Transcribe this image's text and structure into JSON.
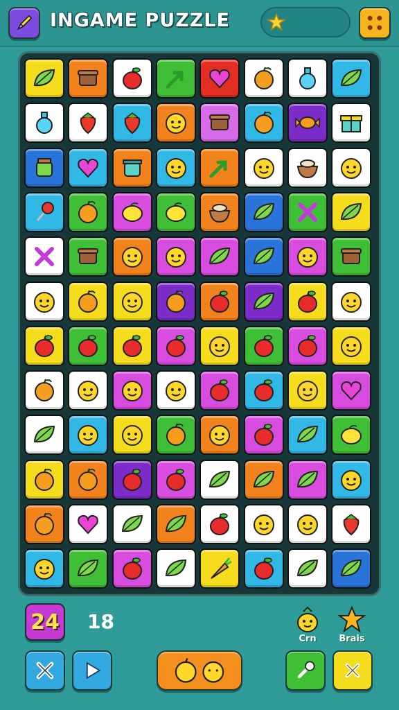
{
  "header": {
    "title": "INGAME  PUZZLE",
    "menu_icon": "pencil-icon",
    "progress_icon": "star-icon",
    "dice_icon": "dice-icon"
  },
  "board": {
    "rows": 12,
    "cols": 8,
    "tiles": [
      [
        "#f5dd1e",
        "#f2831c",
        "#ffffff",
        "#3fbf35",
        "#e32f23",
        "#ffffff",
        "#ffffff",
        "#32b8e6"
      ],
      [
        "#ffffff",
        "#ffffff",
        "#32b8e6",
        "#f2831c",
        "#d76bea",
        "#32b8e6",
        "#7b2cc9",
        "#ffffff"
      ],
      [
        "#2a74d9",
        "#32b8e6",
        "#f2831c",
        "#32b8e6",
        "#f2831c",
        "#ffffff",
        "#ffffff",
        "#ffffff"
      ],
      [
        "#32b8e6",
        "#3fbf35",
        "#d84de0",
        "#3fbf35",
        "#f2831c",
        "#2a74d9",
        "#3fbf35",
        "#f5dd1e"
      ],
      [
        "#ffffff",
        "#3fbf35",
        "#f2831c",
        "#d84de0",
        "#d84de0",
        "#2a74d9",
        "#d84de0",
        "#3fbf35"
      ],
      [
        "#ffffff",
        "#f5dd1e",
        "#f5dd1e",
        "#7b2cc9",
        "#f2831c",
        "#7b2cc9",
        "#f5dd1e",
        "#ffffff"
      ],
      [
        "#f5dd1e",
        "#3fbf35",
        "#f5dd1e",
        "#d84de0",
        "#f5dd1e",
        "#3fbf35",
        "#d84de0",
        "#f5dd1e"
      ],
      [
        "#ffffff",
        "#ffffff",
        "#d84de0",
        "#ffffff",
        "#d84de0",
        "#32b8e6",
        "#f5dd1e",
        "#d84de0"
      ],
      [
        "#ffffff",
        "#32b8e6",
        "#f5dd1e",
        "#3fbf35",
        "#f2831c",
        "#d84de0",
        "#32b8e6",
        "#3fbf35"
      ],
      [
        "#f5dd1e",
        "#f2831c",
        "#7b2cc9",
        "#d84de0",
        "#ffffff",
        "#f2831c",
        "#d84de0",
        "#32b8e6"
      ],
      [
        "#f2831c",
        "#ffffff",
        "#ffffff",
        "#f2831c",
        "#ffffff",
        "#ffffff",
        "#ffffff",
        "#ffffff"
      ],
      [
        "#32b8e6",
        "#3fbf35",
        "#d84de0",
        "#ffffff",
        "#f5dd1e",
        "#32b8e6",
        "#ffffff",
        "#2a74d9"
      ]
    ],
    "icons": [
      [
        "leaf",
        "box",
        "apple",
        "arrow",
        "heart",
        "fruit",
        "bottle",
        "leaf"
      ],
      [
        "bottle",
        "strawberry",
        "strawberry",
        "face",
        "box",
        "fruit",
        "candy",
        "gift"
      ],
      [
        "jar",
        "heart",
        "pot",
        "face",
        "arrow",
        "face",
        "bowl",
        "face"
      ],
      [
        "pin",
        "fruit",
        "lemon",
        "lemon",
        "bowl",
        "leaf",
        "cross",
        "leaf"
      ],
      [
        "cross",
        "box",
        "face",
        "face",
        "leaf",
        "leaf",
        "face",
        "box"
      ],
      [
        "face",
        "fruit",
        "face",
        "fruit",
        "apple",
        "leaf",
        "apple",
        "face"
      ],
      [
        "apple",
        "apple",
        "apple",
        "apple",
        "face",
        "apple",
        "apple",
        "face"
      ],
      [
        "fruit",
        "face",
        "face",
        "face",
        "apple",
        "apple",
        "face",
        "heart"
      ],
      [
        "leaf",
        "face",
        "face",
        "fruit",
        "face",
        "apple",
        "leaf",
        "lemon"
      ],
      [
        "fruit",
        "fruit",
        "apple",
        "apple",
        "leaf",
        "leaf",
        "leaf",
        "face"
      ],
      [
        "fruit",
        "heart",
        "leaf",
        "leaf",
        "apple",
        "face",
        "face",
        "strawberry"
      ],
      [
        "face",
        "leaf",
        "apple",
        "leaf",
        "carrot",
        "apple",
        "leaf",
        "leaf"
      ]
    ]
  },
  "footer": {
    "score": "24",
    "moves": "18",
    "left_label": "Crn",
    "right_label": "Brais",
    "left_icon": "pineapple-icon",
    "right_icon": "star-icon",
    "buttons": [
      "close-icon",
      "play-icon",
      "fruit-icon",
      "pin-icon",
      "close-icon"
    ]
  }
}
